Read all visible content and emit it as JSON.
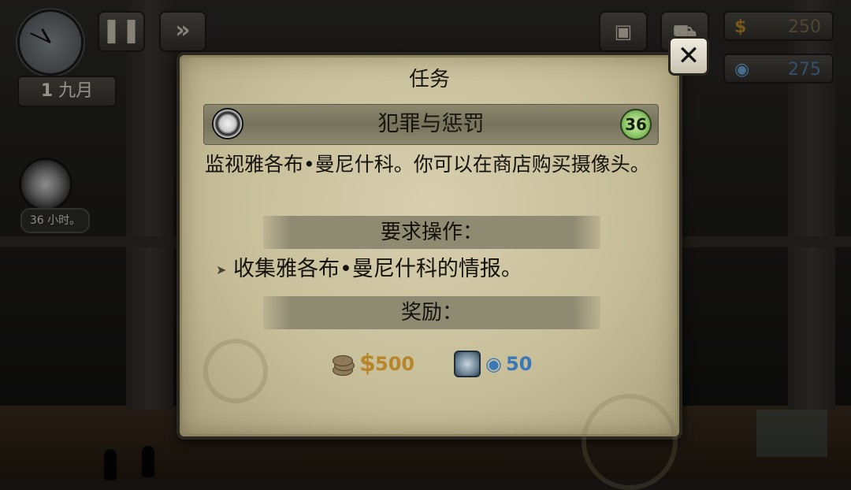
{
  "hud": {
    "pause_icon": "pause-icon",
    "fast_forward_icon": "fast-forward-icon",
    "date_day": "1",
    "date_month": "九月",
    "money": "250",
    "reputation": "275",
    "quest_timer": "36 小时。"
  },
  "dialog": {
    "title": "任务",
    "quest_name": "犯罪与惩罚",
    "quest_level": "36",
    "description": "监视雅各布•曼尼什科。你可以在商店购买摄像头。",
    "requirements_header": "要求操作：",
    "requirement_item": "收集雅各布•曼尼什科的情报。",
    "rewards_header": "奖励：",
    "reward_money_symbol": "$",
    "reward_money": "500",
    "reward_reputation": "50",
    "close_label": "✕"
  },
  "colors": {
    "parchment": "#c6bd98",
    "money_gold": "#b8862a",
    "reputation_blue": "#3a78b8",
    "level_green": "#8ec86a"
  }
}
